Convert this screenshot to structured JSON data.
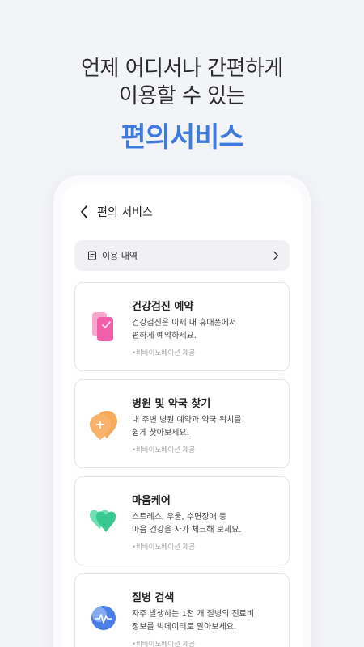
{
  "headline": {
    "line1": "언제 어디서나 간편하게",
    "line2": "이용할 수 있는",
    "accent": "편의서비스"
  },
  "topbar": {
    "title": "편의 서비스"
  },
  "history": {
    "label": "이용 내역"
  },
  "cards": [
    {
      "title": "건강검진 예약",
      "desc_line1": "건강검진은 이제 내 휴대폰에서",
      "desc_line2": "편하게 예약하세요.",
      "provider": "•비바이노베이션 제공",
      "icon": "phone-booking-icon"
    },
    {
      "title": "병원 및 약국 찾기",
      "desc_line1": "내 주변 병원 예약과 약국 위치를",
      "desc_line2": "쉽게 찾아보세요.",
      "provider": "•비바이노베이션 제공",
      "icon": "location-pin-icon"
    },
    {
      "title": "마음케어",
      "desc_line1": "스트레스, 우울, 수면장애 등",
      "desc_line2": "마음 건강을 자가 체크해 보세요.",
      "provider": "•비바이노베이션 제공",
      "icon": "heart-icon"
    },
    {
      "title": "질병 검색",
      "desc_line1": "자주 발생하는 1천 개 질병의 진료비",
      "desc_line2": "정보를 빅데이터로 알아보세요.",
      "provider": "•비바이노베이션 제공",
      "icon": "disease-search-icon"
    }
  ],
  "colors": {
    "accent": "#3e7be0",
    "pink": "#f25fa8",
    "orange": "#f59a3c",
    "green": "#37c98f",
    "blue": "#4a7fe8"
  }
}
